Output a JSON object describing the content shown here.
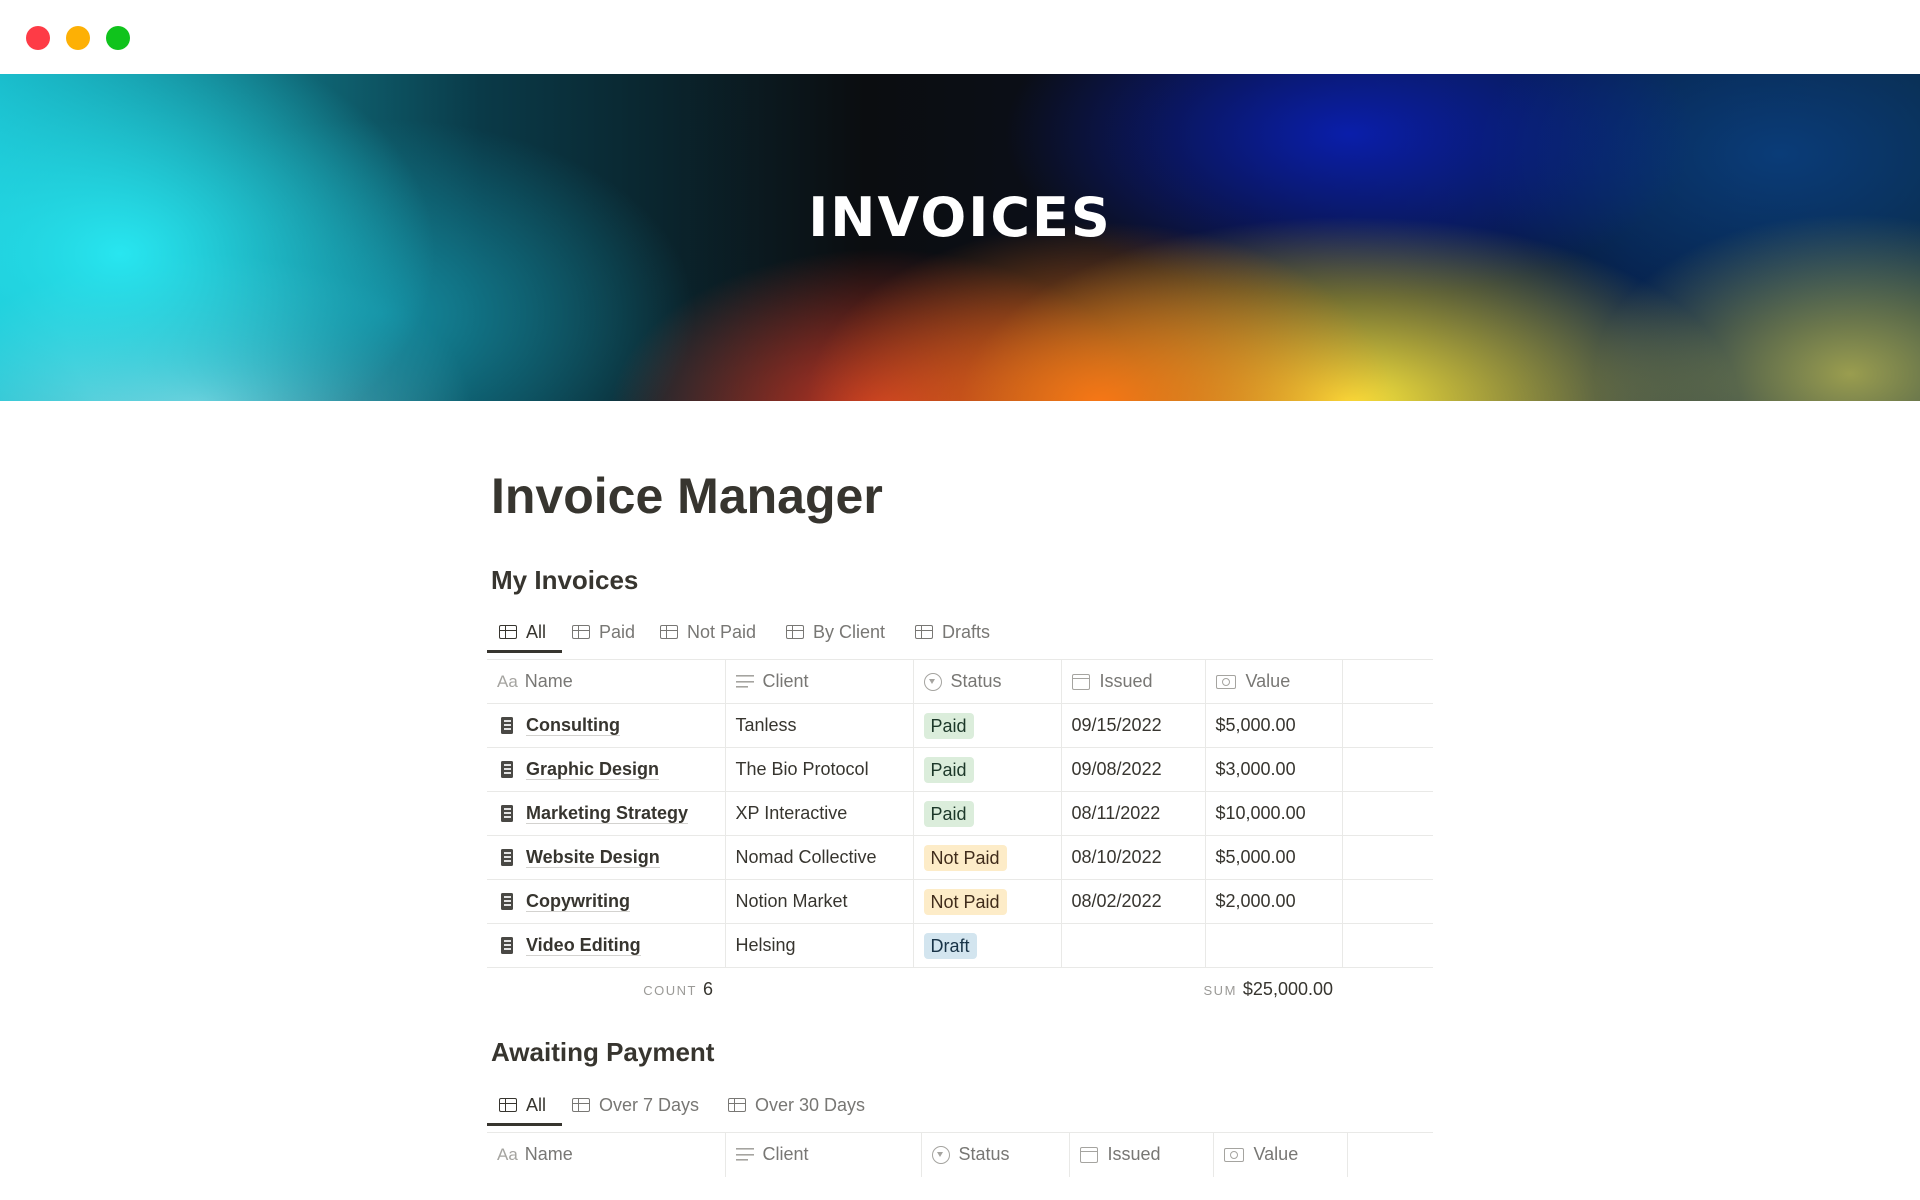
{
  "window": {
    "controls": [
      "close",
      "minimize",
      "zoom"
    ]
  },
  "cover": {
    "title": "INVOICES"
  },
  "page": {
    "title": "Invoice Manager"
  },
  "my_invoices": {
    "title": "My Invoices",
    "tabs": [
      {
        "label": "All",
        "active": true
      },
      {
        "label": "Paid",
        "active": false
      },
      {
        "label": "Not Paid",
        "active": false
      },
      {
        "label": "By Client",
        "active": false
      },
      {
        "label": "Drafts",
        "active": false
      }
    ],
    "columns": [
      {
        "label": "Name",
        "icon": "aa"
      },
      {
        "label": "Client",
        "icon": "lines-icon"
      },
      {
        "label": "Status",
        "icon": "status-icon"
      },
      {
        "label": "Issued",
        "icon": "calendar-icon"
      },
      {
        "label": "Value",
        "icon": "money-icon"
      }
    ],
    "rows": [
      {
        "name": "Consulting",
        "client": "Tanless",
        "status": "Paid",
        "issued": "09/15/2022",
        "value": "$5,000.00"
      },
      {
        "name": "Graphic Design",
        "client": "The Bio Protocol",
        "status": "Paid",
        "issued": "09/08/2022",
        "value": "$3,000.00"
      },
      {
        "name": "Marketing Strategy",
        "client": "XP Interactive",
        "status": "Paid",
        "issued": "08/11/2022",
        "value": "$10,000.00"
      },
      {
        "name": "Website Design",
        "client": "Nomad Collective",
        "status": "Not Paid",
        "issued": "08/10/2022",
        "value": "$5,000.00"
      },
      {
        "name": "Copywriting",
        "client": "Notion Market",
        "status": "Not Paid",
        "issued": "08/02/2022",
        "value": "$2,000.00"
      },
      {
        "name": "Video Editing",
        "client": "Helsing",
        "status": "Draft",
        "issued": "",
        "value": ""
      }
    ],
    "footer": {
      "count_label": "COUNT",
      "count_value": "6",
      "sum_label": "SUM",
      "sum_value": "$25,000.00"
    }
  },
  "awaiting_payment": {
    "title": "Awaiting Payment",
    "tabs": [
      {
        "label": "All",
        "active": true
      },
      {
        "label": "Over 7 Days",
        "active": false
      },
      {
        "label": "Over 30 Days",
        "active": false
      }
    ],
    "columns": [
      {
        "label": "Name",
        "icon": "aa"
      },
      {
        "label": "Client",
        "icon": "lines-icon"
      },
      {
        "label": "Status",
        "icon": "status-icon"
      },
      {
        "label": "Issued",
        "icon": "calendar-icon"
      },
      {
        "label": "Value",
        "icon": "money-icon"
      }
    ]
  },
  "colors": {
    "paid_bg": "#dbeddb",
    "not_paid_bg": "#fdecc8",
    "draft_bg": "#d3e5ef",
    "close": "#fe3b46",
    "minimize": "#fdb005",
    "zoom": "#10c31c"
  }
}
